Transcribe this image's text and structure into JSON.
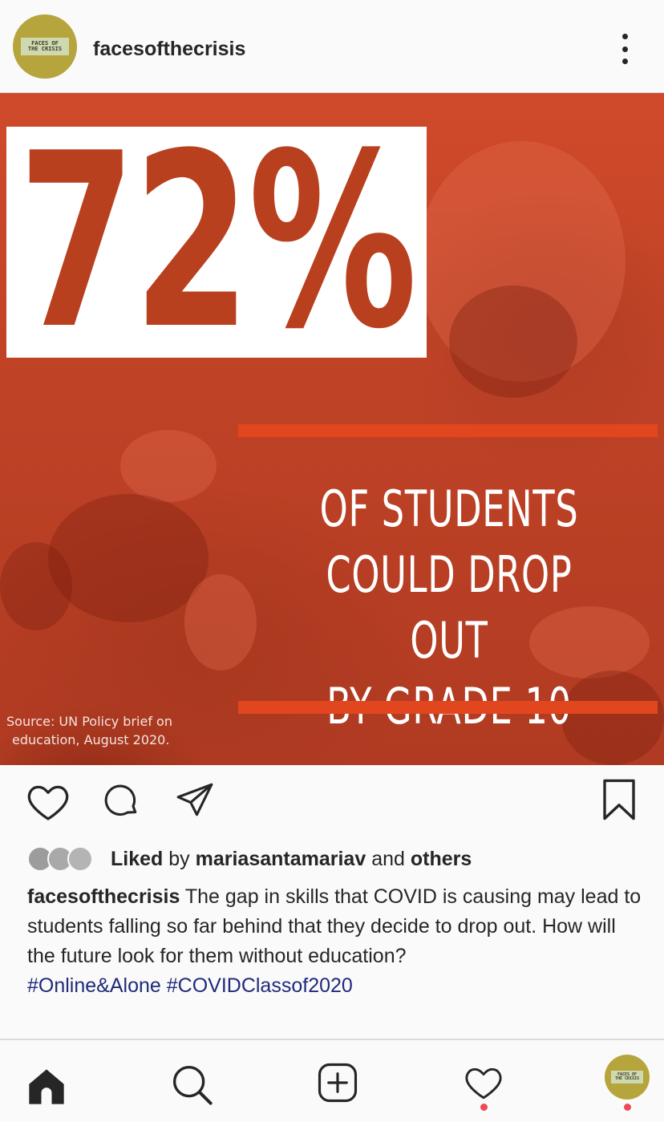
{
  "header": {
    "avatar_text": "FACES OF THE CRISIS",
    "username": "facesofthecrisis",
    "more_icon": "more-vertical-icon"
  },
  "post": {
    "stat_value": "72%",
    "stat_caption_lines": [
      "OF STUDENTS",
      "COULD DROP OUT",
      "BY GRADE 10"
    ],
    "source_lines": [
      "Source: UN Policy brief on",
      "education, August 2020."
    ],
    "colors": {
      "background": "#c4442a",
      "accent_bar": "#e2461f",
      "stat_text": "#b8401f"
    }
  },
  "actions": {
    "like_icon": "heart-icon",
    "comment_icon": "comment-icon",
    "share_icon": "paper-plane-icon",
    "save_icon": "bookmark-icon"
  },
  "likes": {
    "liked": "Liked",
    "by": "by",
    "user": "mariasantamariav",
    "and": "and",
    "others": "others"
  },
  "caption": {
    "username": "facesofthecrisis",
    "text": "The gap in skills that COVID is causing may lead to students falling so far behind that they decide to drop out. How will the future look for them without education?",
    "hashtags": [
      "#Online&Alone",
      "#COVIDClassof2020"
    ]
  },
  "bottom_nav": {
    "items": [
      "home-icon",
      "search-icon",
      "new-post-icon",
      "activity-heart-icon",
      "profile-avatar"
    ],
    "profile_avatar_text": "FACES OF THE CRISIS"
  }
}
